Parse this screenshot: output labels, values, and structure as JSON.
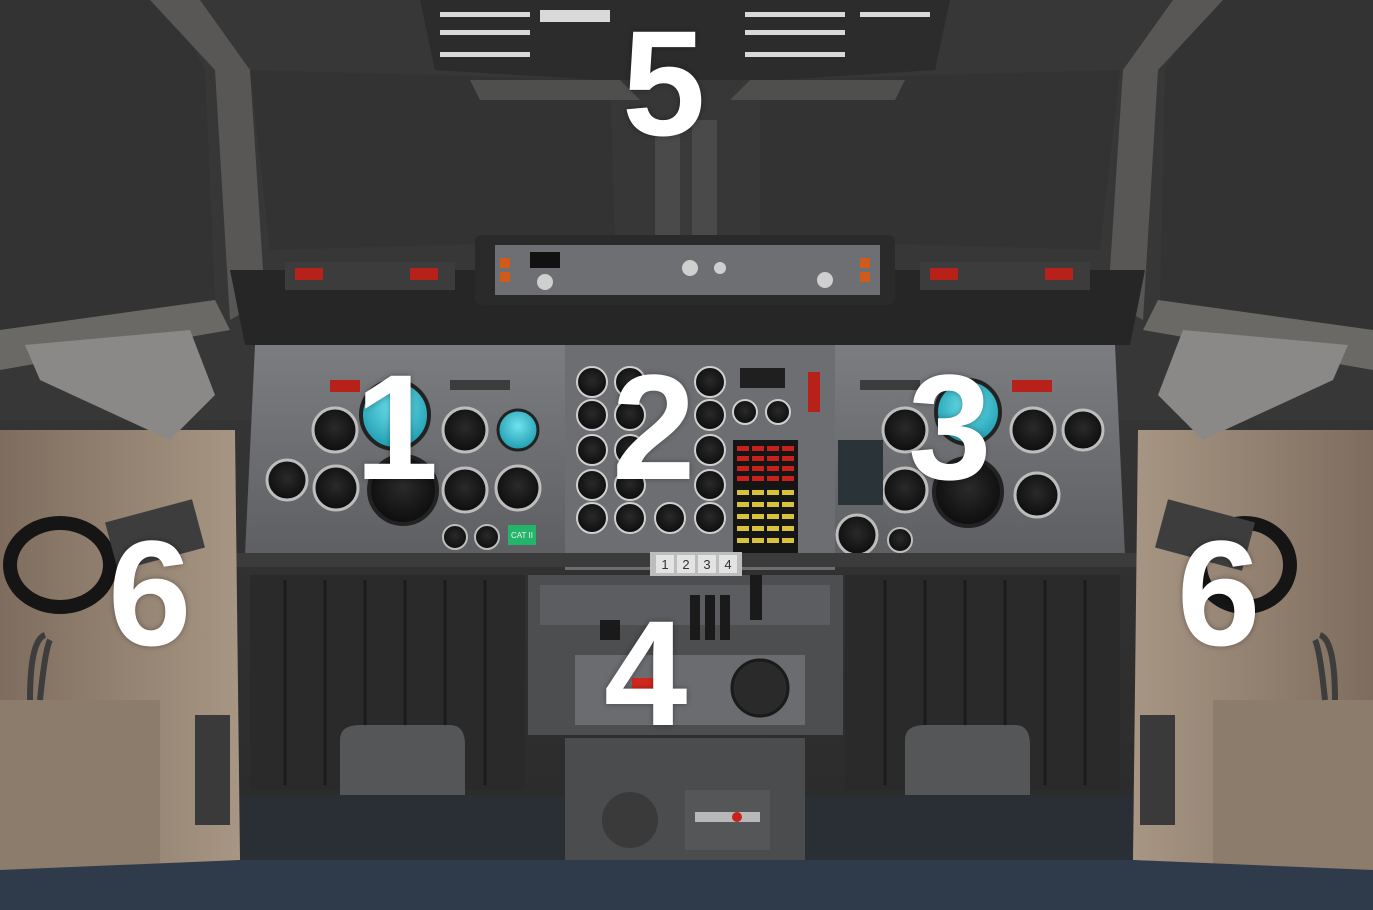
{
  "labels": {
    "panel_1": "1",
    "panel_2": "2",
    "panel_3": "3",
    "panel_4": "4",
    "panel_5": "5",
    "panel_6_left": "6",
    "panel_6_right": "6"
  },
  "placards": {
    "cat_badge": "CAT II"
  },
  "throttle_digits": [
    "1",
    "2",
    "3",
    "4"
  ],
  "colors": {
    "label_white": "#ffffff",
    "instrument_cyan": "#3ac6d6",
    "annunciator_red": "#c8201a",
    "annunciator_yellow": "#d8c23a",
    "floor_blue": "#2f3b4a",
    "sidewall_tan": "#8e7d6c"
  }
}
